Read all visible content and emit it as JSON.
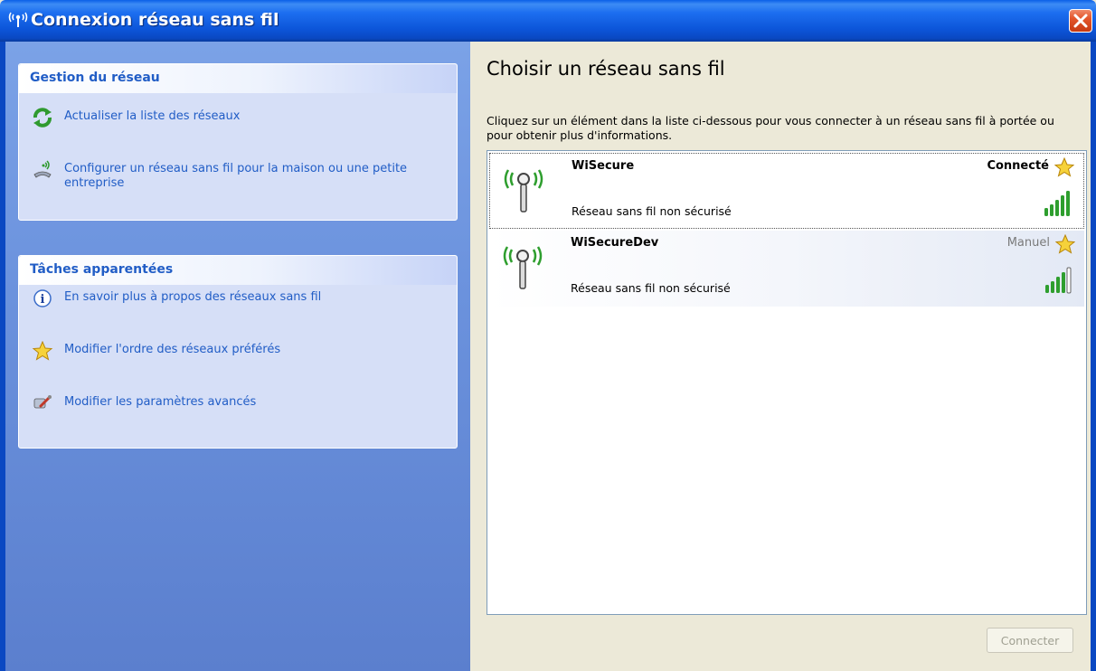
{
  "window": {
    "title": "Connexion réseau sans fil",
    "title_icon": "wireless-icon",
    "close_icon": "close-icon"
  },
  "sidebar": {
    "groups": [
      {
        "title": "Gestion du réseau",
        "items": [
          {
            "label": "Actualiser la liste des réseaux",
            "icon": "refresh-icon"
          },
          {
            "label": "Configurer un réseau sans fil pour la maison ou une petite entreprise",
            "icon": "setup-wizard-icon"
          }
        ]
      },
      {
        "title": "Tâches apparentées",
        "items": [
          {
            "label": "En savoir plus à propos des réseaux sans fil",
            "icon": "info-icon"
          },
          {
            "label": "Modifier l'ordre des réseaux préférés",
            "icon": "star-icon"
          },
          {
            "label": "Modifier les paramètres avancés",
            "icon": "settings-icon"
          }
        ]
      }
    ]
  },
  "main": {
    "heading": "Choisir un réseau sans fil",
    "instructions": "Cliquez sur un élément dans la liste ci-dessous pour vous connecter à un réseau sans fil à portée ou pour obtenir plus d'informations.",
    "networks": [
      {
        "name": "WiSecure",
        "description": "Réseau sans fil non sécurisé",
        "status": "Connecté",
        "selected": true,
        "preferred": true,
        "signal_bars": 5
      },
      {
        "name": "WiSecureDev",
        "description": "Réseau sans fil non sécurisé",
        "status": "Manuel",
        "selected": false,
        "preferred": true,
        "signal_bars": 4
      }
    ],
    "connect_button": "Connecter"
  },
  "colors": {
    "titlebar": "#0a5fe8",
    "taskpane": "#6b92dd",
    "link": "#215dc6",
    "content_bg": "#ece9d8",
    "signal_green": "#2e9e2e"
  }
}
